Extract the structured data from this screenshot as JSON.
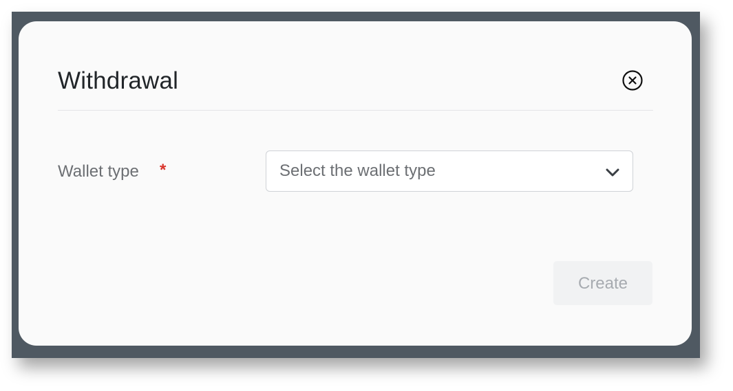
{
  "dialog": {
    "title": "Withdrawal",
    "close_icon": "close-circle-icon"
  },
  "form": {
    "wallet_type": {
      "label": "Wallet type",
      "required_mark": "*",
      "placeholder": "Select the wallet type",
      "dropdown_icon": "chevron-down-icon"
    }
  },
  "actions": {
    "create_label": "Create",
    "create_enabled": false
  },
  "colors": {
    "backdrop": "#4f5962",
    "dialog_bg": "#fafafa",
    "required": "#d9342b",
    "disabled_button_bg": "#f1f2f3",
    "disabled_button_text": "#a7abb0"
  }
}
